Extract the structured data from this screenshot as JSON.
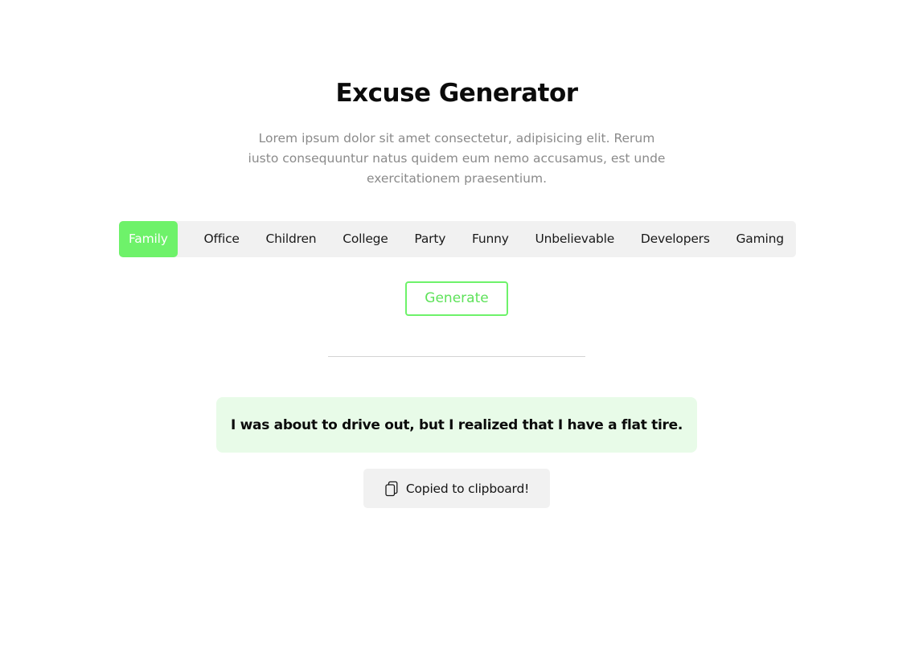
{
  "header": {
    "title": "Excuse Generator",
    "description": "Lorem ipsum dolor sit amet consectetur, adipisicing elit. Rerum iusto consequuntur natus quidem eum nemo accusamus, est unde exercitationem praesentium."
  },
  "categories": {
    "active": "Family",
    "items": [
      {
        "label": "Family"
      },
      {
        "label": "Office"
      },
      {
        "label": "Children"
      },
      {
        "label": "College"
      },
      {
        "label": "Party"
      },
      {
        "label": "Funny"
      },
      {
        "label": "Unbelievable"
      },
      {
        "label": "Developers"
      },
      {
        "label": "Gaming"
      }
    ]
  },
  "actions": {
    "generate_label": "Generate"
  },
  "result": {
    "excuse": "I was about to drive out, but I realized that I have a flat tire."
  },
  "clipboard": {
    "icon": "copy-icon",
    "label": "Copied to clipboard!"
  },
  "colors": {
    "accent": "#6ef26a",
    "excuse_background": "#e8fbe8",
    "muted_text": "#8a8a8a",
    "tab_background": "#f1f1f1"
  }
}
